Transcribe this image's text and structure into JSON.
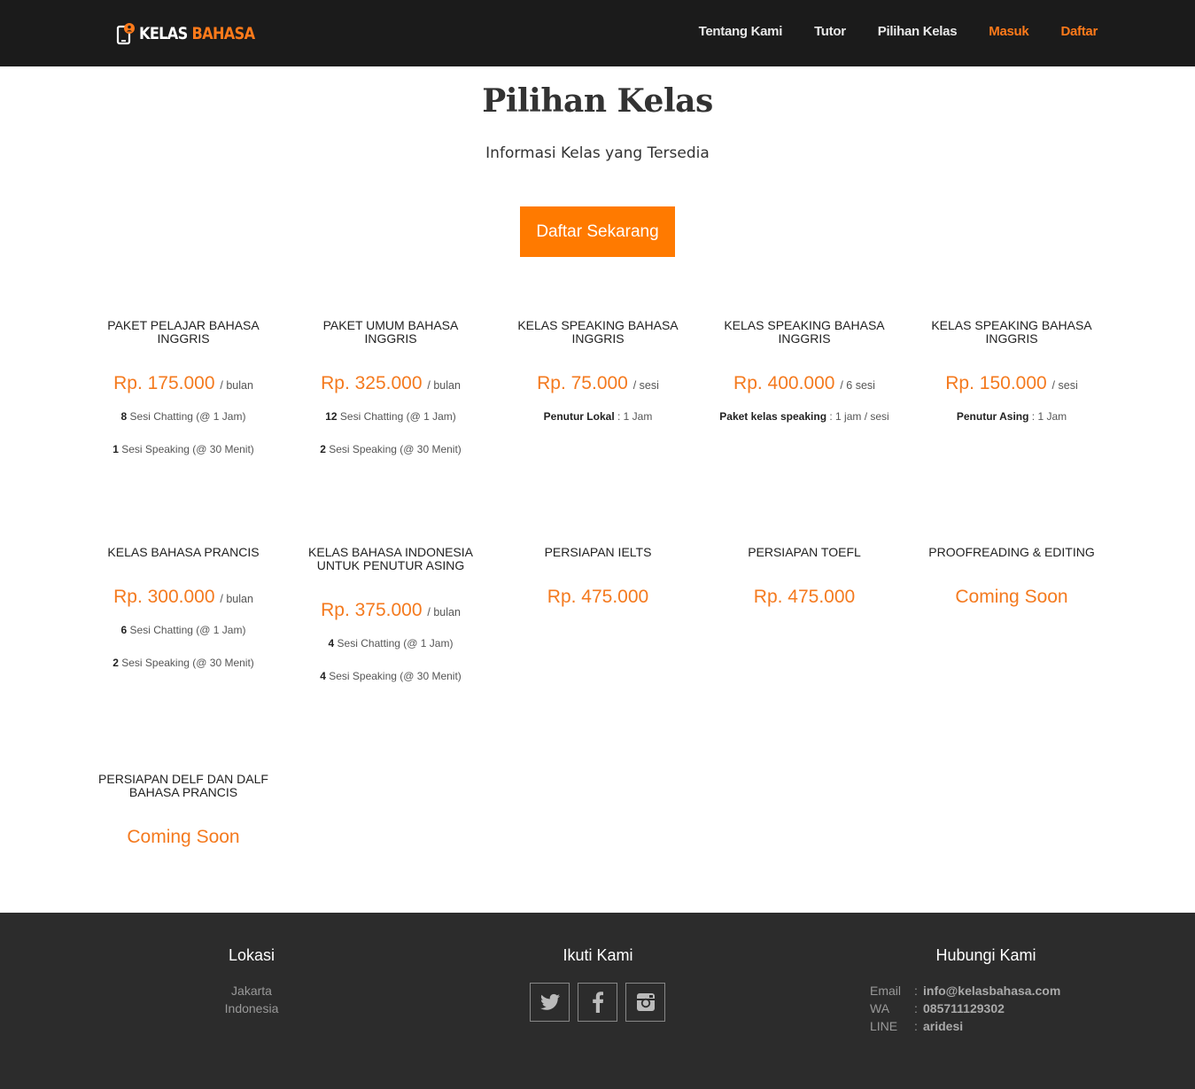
{
  "header": {
    "logo": {
      "word1": "KELAS",
      "word2": "BAHASA"
    },
    "nav": [
      {
        "label": "Tentang Kami"
      },
      {
        "label": "Tutor"
      },
      {
        "label": "Pilihan Kelas"
      },
      {
        "label": "Masuk"
      },
      {
        "label": "Daftar"
      }
    ]
  },
  "hero": {
    "title": "Pilihan Kelas",
    "subtitle": "Informasi Kelas yang Tersedia",
    "cta_label": "Daftar Sekarang"
  },
  "classes": [
    {
      "title": "PAKET PELAJAR BAHASA INGGRIS",
      "price": "Rp. 175.000",
      "unit": "/ bulan",
      "features": [
        {
          "bold": "8",
          "text": " Sesi Chatting (@ 1 Jam)"
        },
        {
          "bold": "1",
          "text": " Sesi Speaking (@ 30 Menit)"
        }
      ]
    },
    {
      "title": "PAKET UMUM BAHASA INGGRIS",
      "price": "Rp. 325.000",
      "unit": "/ bulan",
      "features": [
        {
          "bold": "12",
          "text": " Sesi Chatting (@ 1 Jam)"
        },
        {
          "bold": "2",
          "text": " Sesi Speaking (@ 30 Menit)"
        }
      ]
    },
    {
      "title": "KELAS SPEAKING BAHASA INGGRIS",
      "price": "Rp. 75.000",
      "unit": "/ sesi",
      "features": [
        {
          "bold": "Penutur Lokal",
          "text": " : 1 Jam"
        }
      ]
    },
    {
      "title": "KELAS SPEAKING BAHASA INGGRIS",
      "price": "Rp. 400.000",
      "unit": "/ 6 sesi",
      "features": [
        {
          "bold": "Paket kelas speaking",
          "text": " : 1 jam / sesi"
        }
      ]
    },
    {
      "title": "KELAS SPEAKING BAHASA INGGRIS",
      "price": "Rp. 150.000",
      "unit": "/ sesi",
      "features": [
        {
          "bold": "Penutur Asing",
          "text": " : 1 Jam"
        }
      ]
    },
    {
      "title": "KELAS BAHASA PRANCIS",
      "price": "Rp. 300.000",
      "unit": "/ bulan",
      "features": [
        {
          "bold": "6",
          "text": " Sesi Chatting (@ 1 Jam)"
        },
        {
          "bold": "2",
          "text": " Sesi Speaking (@ 30 Menit)"
        }
      ]
    },
    {
      "title": "KELAS BAHASA INDONESIA UNTUK PENUTUR ASING",
      "price": "Rp. 375.000",
      "unit": "/ bulan",
      "features": [
        {
          "bold": "4",
          "text": " Sesi Chatting (@ 1 Jam)"
        },
        {
          "bold": "4",
          "text": " Sesi Speaking (@ 30 Menit)"
        }
      ]
    },
    {
      "title": "PERSIAPAN IELTS",
      "price": "Rp. 475.000",
      "unit": "",
      "features": []
    },
    {
      "title": "PERSIAPAN TOEFL",
      "price": "Rp. 475.000",
      "unit": "",
      "features": []
    },
    {
      "title": "PROOFREADING & EDITING",
      "price": "Coming Soon",
      "unit": "",
      "features": []
    },
    {
      "title": "PERSIAPAN DELF DAN DALF BAHASA PRANCIS",
      "price": "Coming Soon",
      "unit": "",
      "features": []
    }
  ],
  "footer": {
    "location": {
      "heading": "Lokasi",
      "line1": "Jakarta",
      "line2": "Indonesia"
    },
    "follow": {
      "heading": "Ikuti Kami",
      "icons": [
        "twitter-icon",
        "facebook-icon",
        "instagram-icon"
      ]
    },
    "contact": {
      "heading": "Hubungi Kami",
      "rows": [
        {
          "key": "Email",
          "sep": ":",
          "value": "info@kelasbahasa.com"
        },
        {
          "key": "WA",
          "sep": ":",
          "value": "085711129302"
        },
        {
          "key": "LINE",
          "sep": ":",
          "value": "aridesi"
        }
      ]
    }
  },
  "colors": {
    "accent": "#ff7a00",
    "header_bg": "#1b1b1b",
    "footer_bg": "#2c2c2c",
    "price": "#f47a1f"
  }
}
